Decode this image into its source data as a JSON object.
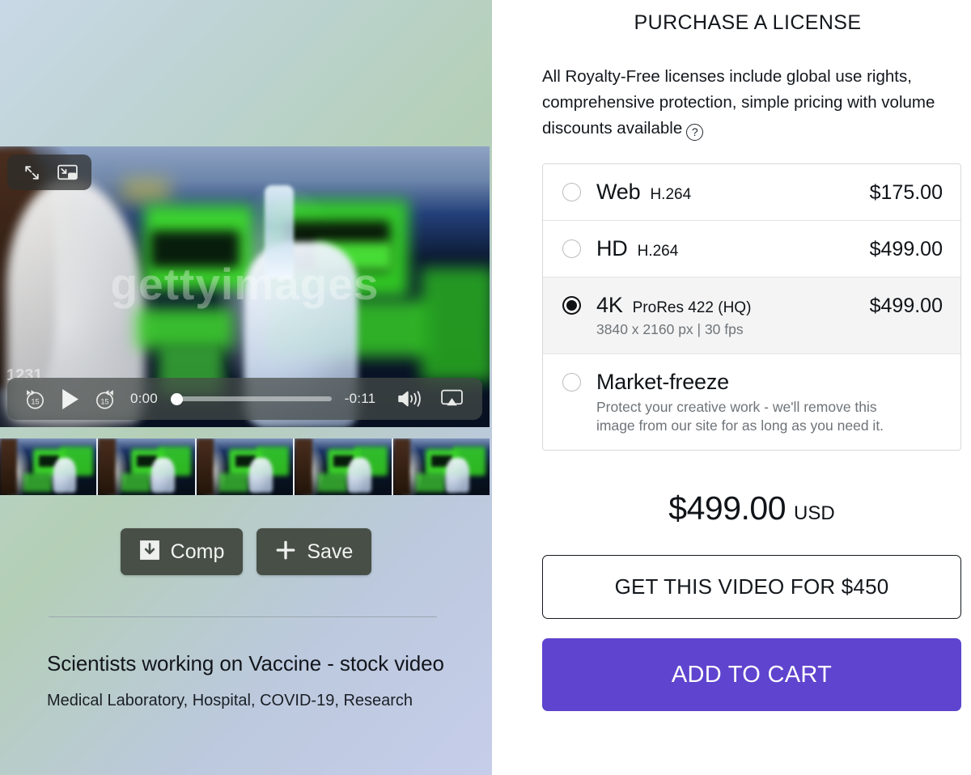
{
  "left": {
    "video": {
      "top_controls": [
        {
          "name": "fullscreen-icon",
          "label": "Fullscreen"
        },
        {
          "name": "picture-in-picture-icon",
          "label": "Picture in Picture"
        }
      ],
      "watermark": "gettyimages",
      "watermark_number": "1231",
      "player": {
        "skip_back_label": "15",
        "skip_forward_label": "15",
        "current_time": "0:00",
        "remaining_time": "-0:11",
        "progress_percent": 0
      }
    },
    "buttons": {
      "comp": "Comp",
      "save": "Save"
    },
    "meta": {
      "title": "Scientists working on Vaccine - stock video",
      "keywords": "Medical Laboratory, Hospital, COVID-19, Research"
    }
  },
  "right": {
    "heading": "PURCHASE A LICENSE",
    "description": "All Royalty-Free licenses include global use rights, comprehensive protection, simple pricing with volume discounts available",
    "help_icon": "question-mark-icon",
    "licenses": [
      {
        "name": "Web",
        "codec": "H.264",
        "detail": "",
        "price": "$175.00",
        "selected": false
      },
      {
        "name": "HD",
        "codec": "H.264",
        "detail": "",
        "price": "$499.00",
        "selected": false
      },
      {
        "name": "4K",
        "codec": "ProRes 422 (HQ)",
        "detail": "3840 x 2160 px | 30 fps",
        "price": "$499.00",
        "selected": true
      },
      {
        "name": "Market-freeze",
        "codec": "",
        "detail": "Protect your creative work - we'll remove this image from our site for as long as you need it.",
        "price": "",
        "selected": false
      }
    ],
    "total": {
      "amount": "$499.00",
      "currency": "USD"
    },
    "get_video_button": "GET THIS VIDEO FOR $450",
    "add_to_cart_button": "ADD TO CART"
  },
  "colors": {
    "accent": "#5e44ce",
    "selected_row_bg": "#f4f4f4",
    "button_dark": "#474f47"
  }
}
